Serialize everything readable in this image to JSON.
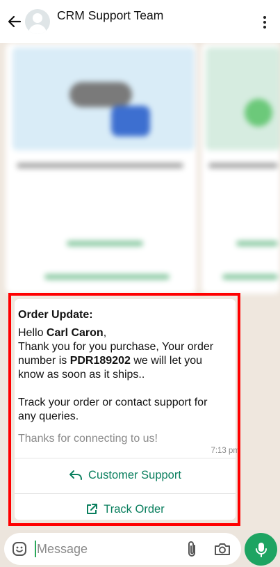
{
  "header": {
    "title": "CRM Support Team",
    "back_icon": "arrow-left-icon",
    "menu_icon": "more-vertical-icon"
  },
  "message": {
    "title": "Order Update:",
    "greeting_prefix": "Hello ",
    "customer_name": "Carl Caron",
    "greeting_suffix": ",",
    "line_thanks": "Thank you for you purchase, Your order number is ",
    "order_number": "PDR189202",
    "line_after_order": " we will let you know as soon as it ships..",
    "line_track": "Track your order or contact support for any queries.",
    "footer": "Thanks for connecting to us!",
    "timestamp": "7:13 pm"
  },
  "actions": {
    "support_label": "Customer Support",
    "track_label": "Track Order"
  },
  "composer": {
    "placeholder": "Message"
  },
  "colors": {
    "accent_green": "#1da462",
    "link_green": "#0a7f5e",
    "highlight_red": "#ff0000"
  }
}
